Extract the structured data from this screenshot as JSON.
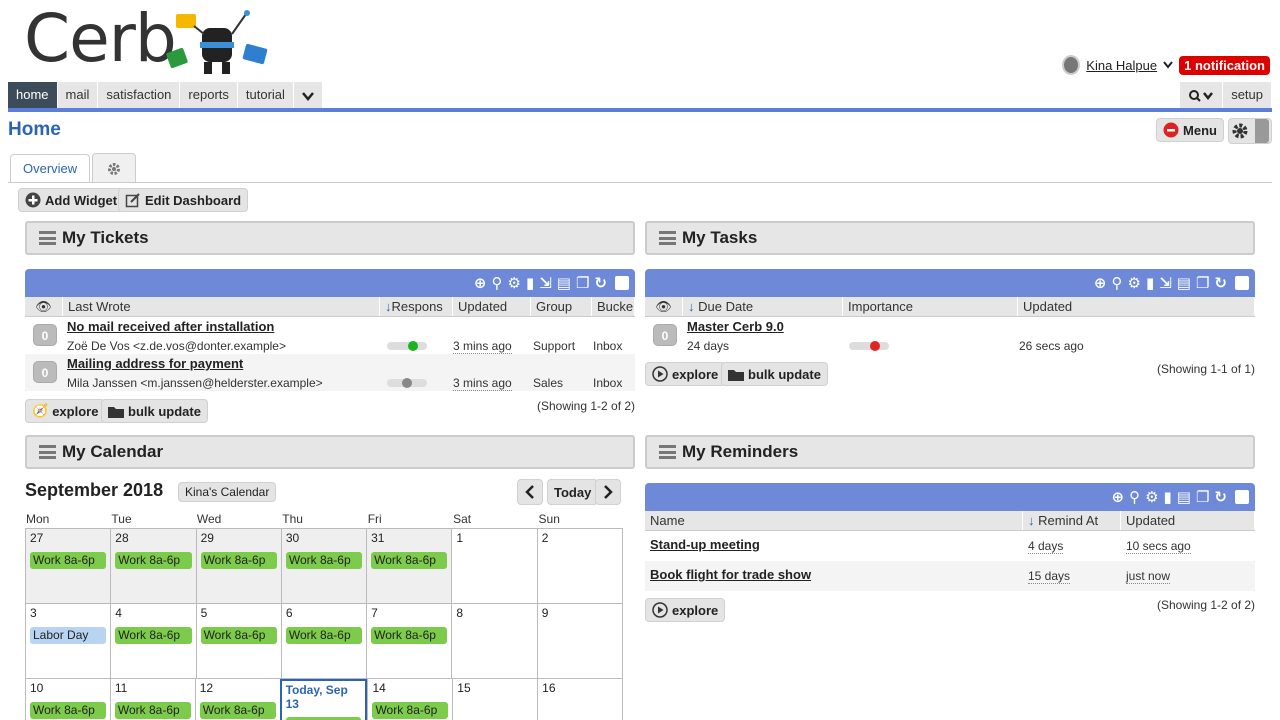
{
  "brand": {
    "logo_text": "Cerb"
  },
  "user": {
    "name": "Kina Halpue",
    "notification": "1 notification"
  },
  "nav": {
    "tabs": [
      "home",
      "mail",
      "satisfaction",
      "reports",
      "tutorial"
    ],
    "setup": "setup"
  },
  "page": {
    "title": "Home",
    "menu_label": "Menu"
  },
  "page_tabs": {
    "overview": "Overview"
  },
  "dashboard": {
    "add_widget": "Add Widget",
    "edit_dashboard": "Edit Dashboard"
  },
  "tickets": {
    "title": "My Tickets",
    "columns": [
      "Last Wrote",
      "Respons",
      "Updated",
      "Group",
      "Bucke"
    ],
    "rows": [
      {
        "count": "0",
        "subject": "No mail received after installation",
        "from": "Zoë De Vos <z.de.vos@donter.example>",
        "updated": "3 mins ago",
        "group": "Support",
        "bucket": "Inbox"
      },
      {
        "count": "0",
        "subject": "Mailing address for payment",
        "from": "Mila Janssen <m.janssen@helderster.example>",
        "updated": "3 mins ago",
        "group": "Sales",
        "bucket": "Inbox"
      }
    ],
    "explore": "explore",
    "bulk_update": "bulk update",
    "showing": "(Showing 1-2 of 2)"
  },
  "tasks": {
    "title": "My Tasks",
    "columns": [
      "Due Date",
      "Importance",
      "Updated"
    ],
    "rows": [
      {
        "count": "0",
        "title": "Master Cerb 9.0",
        "due": "24 days",
        "updated": "26 secs ago"
      }
    ],
    "explore": "explore",
    "bulk_update": "bulk update",
    "showing": "(Showing 1-1 of 1)"
  },
  "calendar": {
    "title": "My Calendar",
    "month": "September 2018",
    "calendar_name": "Kina's Calendar",
    "today_label": "Today",
    "dows": [
      "Mon",
      "Tue",
      "Wed",
      "Thu",
      "Fri",
      "Sat",
      "Sun"
    ],
    "weeks": [
      [
        {
          "d": "27",
          "ev": "Work 8a-6p"
        },
        {
          "d": "28",
          "ev": "Work 8a-6p"
        },
        {
          "d": "29",
          "ev": "Work 8a-6p"
        },
        {
          "d": "30",
          "ev": "Work 8a-6p"
        },
        {
          "d": "31",
          "ev": "Work 8a-6p"
        },
        {
          "d": "1",
          "ev": ""
        },
        {
          "d": "2",
          "ev": ""
        }
      ],
      [
        {
          "d": "3",
          "ev": "Labor Day"
        },
        {
          "d": "4",
          "ev": "Work 8a-6p"
        },
        {
          "d": "5",
          "ev": "Work 8a-6p"
        },
        {
          "d": "6",
          "ev": "Work 8a-6p"
        },
        {
          "d": "7",
          "ev": "Work 8a-6p"
        },
        {
          "d": "8",
          "ev": ""
        },
        {
          "d": "9",
          "ev": ""
        }
      ],
      [
        {
          "d": "10",
          "ev": "Work 8a-6p"
        },
        {
          "d": "11",
          "ev": "Work 8a-6p"
        },
        {
          "d": "12",
          "ev": "Work 8a-6p"
        },
        {
          "d": "Today, Sep 13",
          "ev": ""
        },
        {
          "d": "14",
          "ev": "Work 8a-6p"
        },
        {
          "d": "15",
          "ev": ""
        },
        {
          "d": "16",
          "ev": ""
        }
      ]
    ]
  },
  "reminders": {
    "title": "My Reminders",
    "columns": [
      "Name",
      "Remind At",
      "Updated"
    ],
    "rows": [
      {
        "name": "Stand-up meeting",
        "remind": "4 days",
        "updated": "10 secs ago"
      },
      {
        "name": "Book flight for trade show",
        "remind": "15 days",
        "updated": "just now"
      }
    ],
    "explore": "explore",
    "showing": "(Showing 1-2 of 2)"
  },
  "colors": {
    "accent": "#5b7fd8",
    "worklist_bar": "#6d89d8",
    "event_green": "#7dcb4a",
    "holiday_blue": "#b8d4f2",
    "notification_red": "#dd0000",
    "title_blue": "#2b65b2"
  }
}
